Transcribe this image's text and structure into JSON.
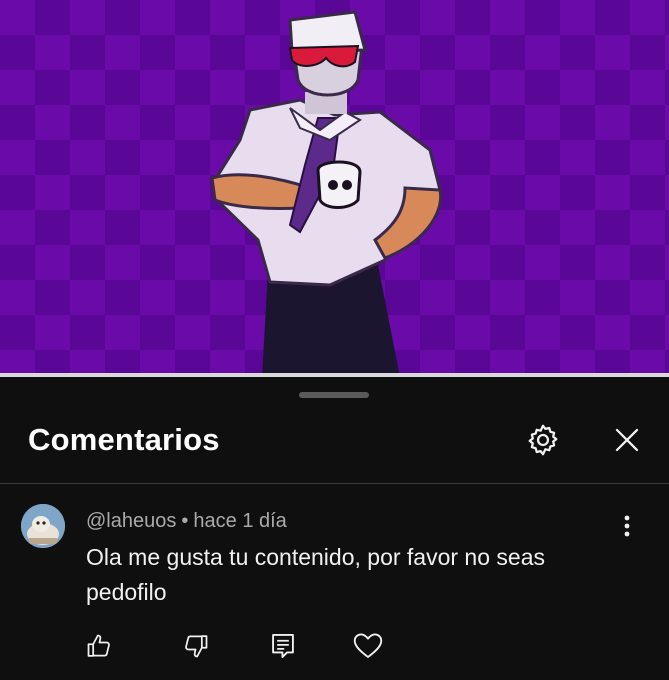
{
  "sheet": {
    "title": "Comentarios",
    "settings_icon": "gear-icon",
    "close_icon": "close-icon"
  },
  "comment": {
    "author": "@laheuos",
    "separator": "•",
    "time": "hace 1 día",
    "text": "Ola me gusta tu contenido, por favor no seas pedofilo",
    "actions": {
      "like_icon": "thumbs-up-icon",
      "dislike_icon": "thumbs-down-icon",
      "reply_icon": "reply-icon",
      "heart_icon": "heart-icon",
      "more_icon": "more-vertical-icon"
    }
  },
  "colors": {
    "video_bg": "#6a0aa8",
    "sheet_bg": "#0f0f0f",
    "text_primary": "#f1f1f1",
    "text_secondary": "#aaaaaa"
  }
}
